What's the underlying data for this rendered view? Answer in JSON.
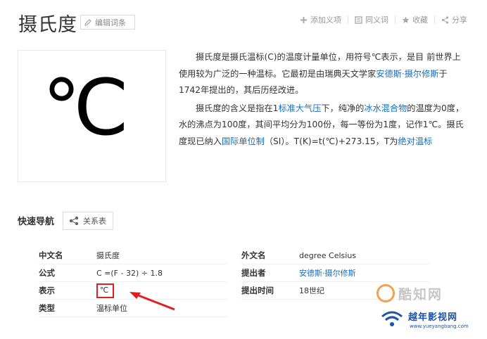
{
  "header": {
    "title": "摄氏度",
    "edit_label": "编辑词条",
    "actions": [
      {
        "label": "添加义项",
        "icon": "plus-icon"
      },
      {
        "label": "同义词",
        "icon": "synonym-icon"
      },
      {
        "label": "收藏",
        "icon": "star-icon"
      },
      {
        "label": "分享",
        "icon": "share-icon"
      }
    ]
  },
  "image": {
    "symbol": "℃"
  },
  "summary": {
    "p1_a": "摄氏度是摄氏温标(C)的温度计量单位，用符号℃表示，是目 前世界上使用较为广泛的一种温标。它最初是由瑞典天文学家",
    "p1_link": "安德斯·摄尔修斯",
    "p1_b": "于1742年提出的，其后历经改进。",
    "p2_a": "摄氏度的含义是指在1",
    "p2_link1": "标准大气压",
    "p2_b": "下，纯净的",
    "p2_link2": "冰水混合物",
    "p2_c": "的温度为0度，水的沸点为100度，其间平均分为100份，每一等份为1度，记作1℃。摄氏度现已纳入",
    "p2_link3": "国际单位制",
    "p2_d": "（SI）。T(K)=t(℃)+273.15，T为",
    "p2_link4": "绝对温标"
  },
  "quicknav": {
    "label": "快速导航",
    "button": "关系表"
  },
  "info_left": [
    {
      "key": "中文名",
      "value": "摄氏度"
    },
    {
      "key": "公式",
      "value": "C =(F - 32) ÷ 1.8"
    },
    {
      "key": "表示",
      "value": "℃"
    },
    {
      "key": "类型",
      "value": "温标单位"
    }
  ],
  "info_right": [
    {
      "key": "外文名",
      "value": "degree Celsius"
    },
    {
      "key": "提出者",
      "value": "安德斯·摄尔修斯"
    },
    {
      "key": "提出时间",
      "value": "18世纪"
    }
  ],
  "watermark": {
    "line1": "酷知网",
    "line2": "越年影视网",
    "line3": "www.yueyangbang.com"
  },
  "colors": {
    "link": "#136ec2",
    "highlight": "#e02020"
  }
}
